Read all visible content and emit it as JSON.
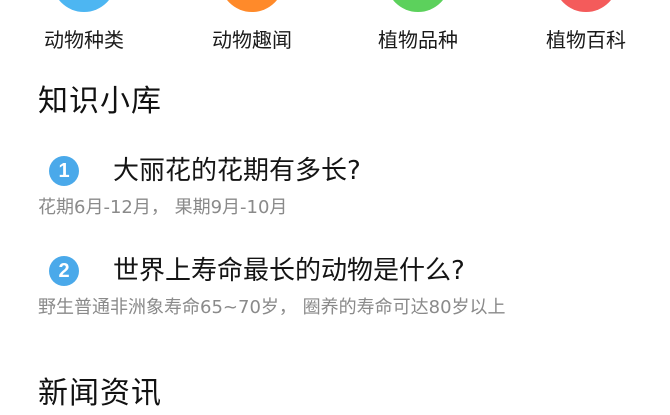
{
  "categories": [
    {
      "label": "动物种类",
      "color": "#4db6f2",
      "icon": "animal-types-icon"
    },
    {
      "label": "动物趣闻",
      "color": "#ff8a2a",
      "icon": "animal-trivia-icon"
    },
    {
      "label": "植物品种",
      "color": "#5cd15c",
      "icon": "plant-varieties-icon"
    },
    {
      "label": "植物百科",
      "color": "#f45b5b",
      "icon": "plant-encyclopedia-icon"
    }
  ],
  "knowledge": {
    "title": "知识小库",
    "badge_color": "#4aa9ea",
    "items": [
      {
        "number": "1",
        "question": "大丽花的花期有多长?",
        "answer": "花期6月-12月， 果期9月-10月"
      },
      {
        "number": "2",
        "question": "世界上寿命最长的动物是什么?",
        "answer": "野生普通非洲象寿命65~70岁， 圈养的寿命可达80岁以上"
      }
    ]
  },
  "news": {
    "title": "新闻资讯"
  }
}
